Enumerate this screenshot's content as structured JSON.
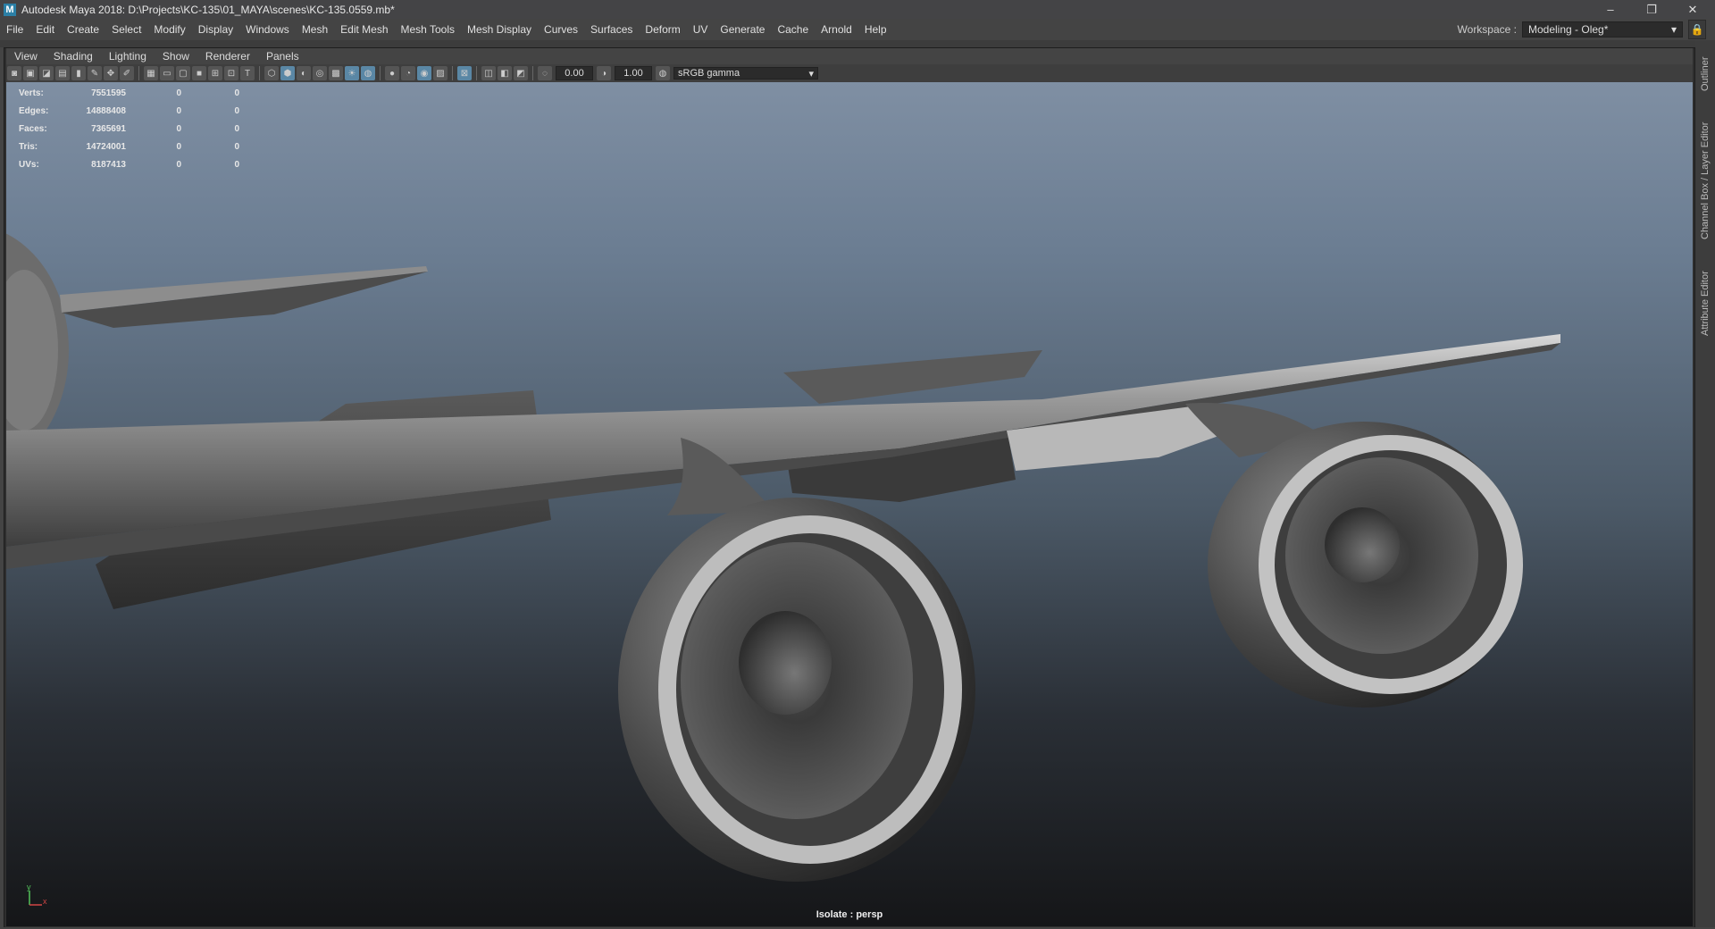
{
  "window": {
    "title": "Autodesk Maya 2018: D:\\Projects\\KC-135\\01_MAYA\\scenes\\KC-135.0559.mb*",
    "app_icon": "M",
    "controls": {
      "minimize": "–",
      "restore": "❐",
      "close": "✕"
    }
  },
  "menubar": {
    "items": [
      "File",
      "Edit",
      "Create",
      "Select",
      "Modify",
      "Display",
      "Windows",
      "Mesh",
      "Edit Mesh",
      "Mesh Tools",
      "Mesh Display",
      "Curves",
      "Surfaces",
      "Deform",
      "UV",
      "Generate",
      "Cache",
      "Arnold",
      "Help"
    ]
  },
  "workspace": {
    "label": "Workspace :",
    "value": "Modeling - Oleg*"
  },
  "panel_menu": {
    "items": [
      "View",
      "Shading",
      "Lighting",
      "Show",
      "Renderer",
      "Panels"
    ]
  },
  "view_toolbar": {
    "exposure": "0.00",
    "gamma": "1.00",
    "color_space": "sRGB gamma"
  },
  "hud": {
    "rows": [
      {
        "label": "Verts:",
        "value": "7551595",
        "sel": "0",
        "comp": "0"
      },
      {
        "label": "Edges:",
        "value": "14888408",
        "sel": "0",
        "comp": "0"
      },
      {
        "label": "Faces:",
        "value": "7365691",
        "sel": "0",
        "comp": "0"
      },
      {
        "label": "Tris:",
        "value": "14724001",
        "sel": "0",
        "comp": "0"
      },
      {
        "label": "UVs:",
        "value": "8187413",
        "sel": "0",
        "comp": "0"
      }
    ]
  },
  "viewport": {
    "camera_label": "Isolate : persp"
  },
  "axis": {
    "y": "y",
    "x": "x"
  },
  "side_tabs": [
    "Outliner",
    "Channel Box / Layer Editor",
    "Attribute Editor"
  ],
  "colors": {
    "accent": "#5a87a5",
    "menu_bg": "#444444",
    "viewport_top": "#7f8fa3",
    "viewport_bottom": "#151618"
  }
}
